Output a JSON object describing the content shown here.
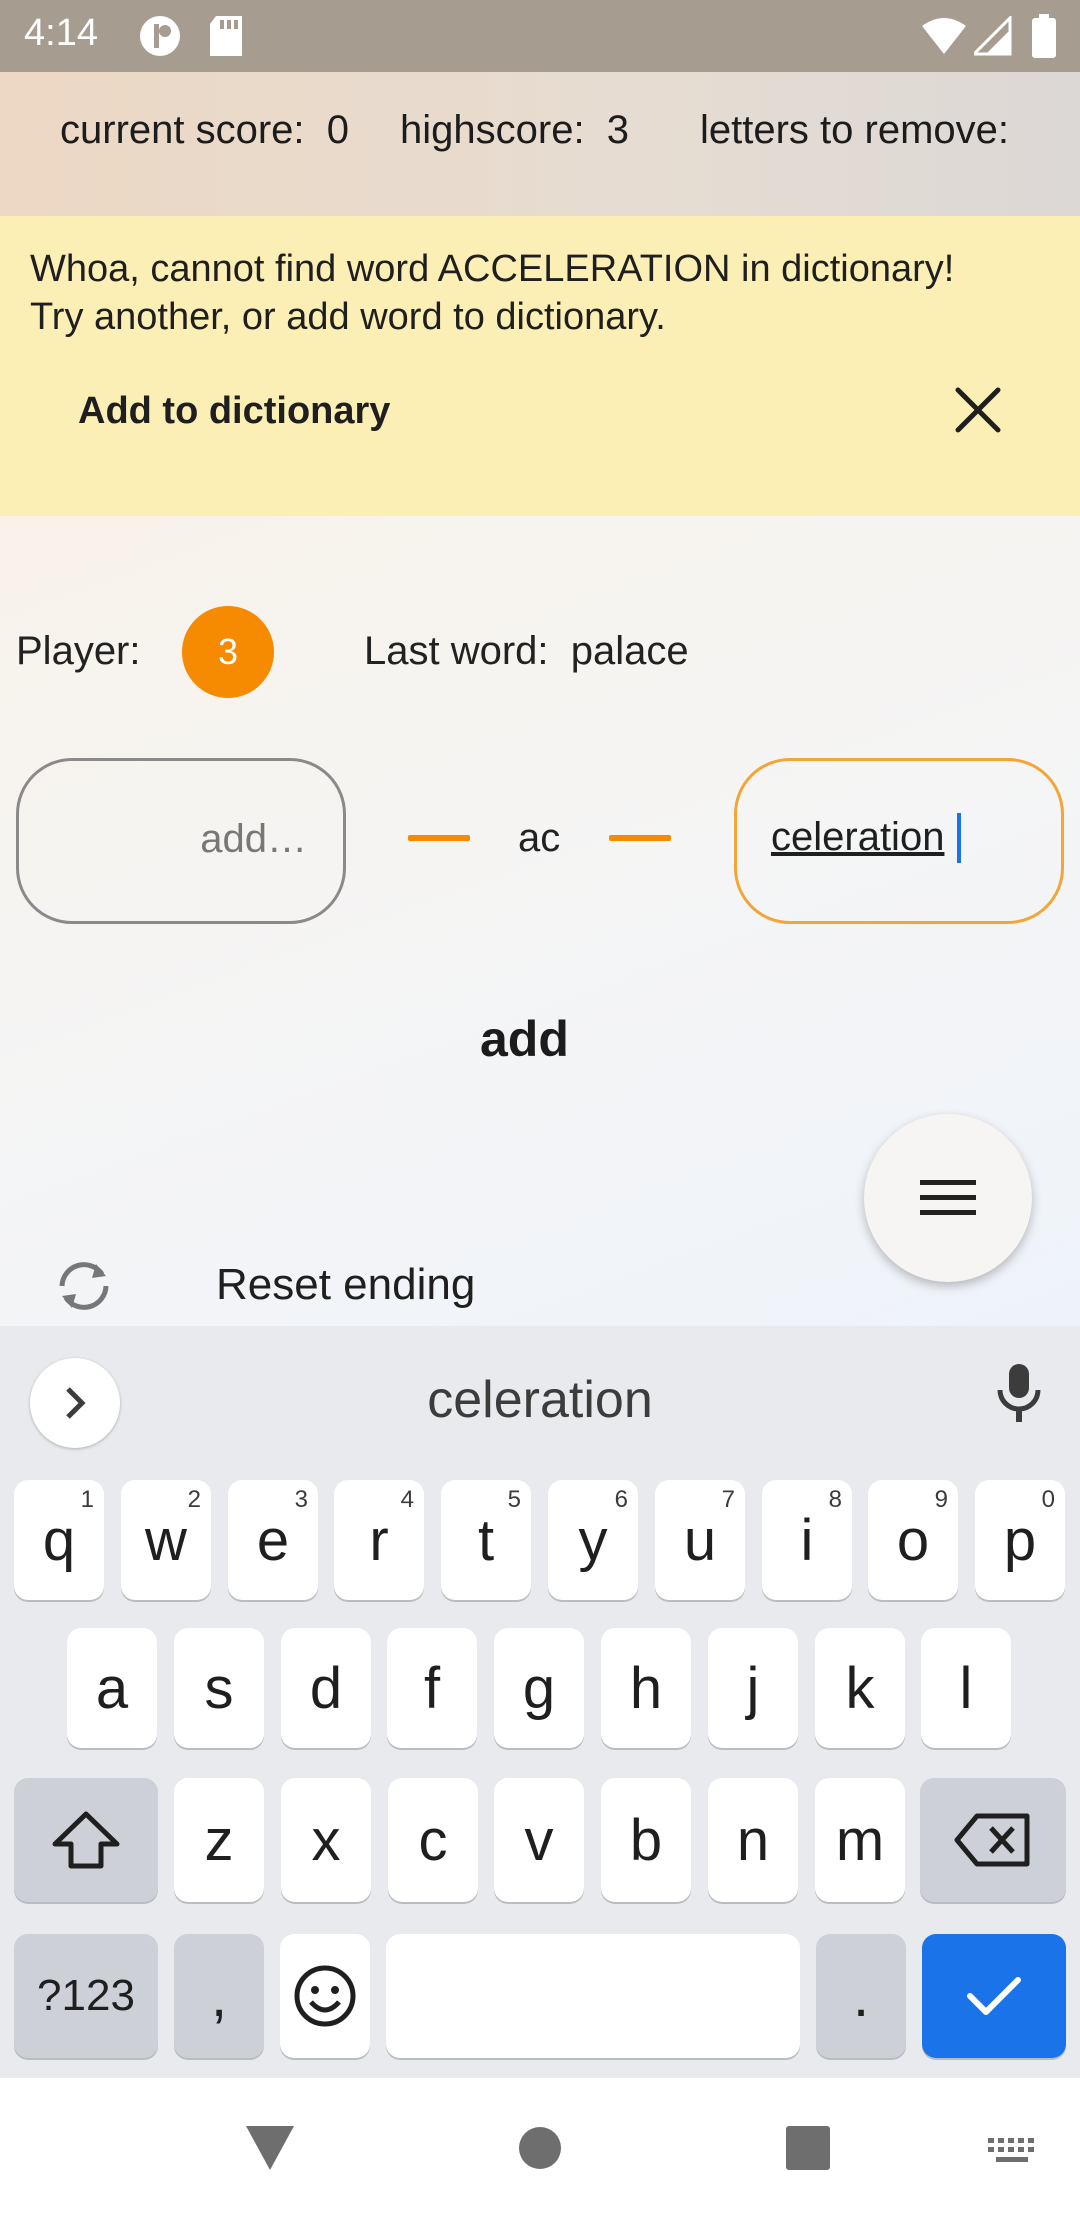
{
  "status_bar": {
    "time": "4:14"
  },
  "score_bar": {
    "current_score": "current score:  0",
    "highscore": "highscore:  3",
    "letters_to_remove": "letters to remove:"
  },
  "banner": {
    "line1": "Whoa, cannot find word ACCELERATION in dictionary!",
    "line2": "Try another, or add word to dictionary.",
    "action": "Add to dictionary",
    "bg_color": "#fcefb6"
  },
  "game": {
    "player_label": "Player:",
    "player_number": "3",
    "last_word": "Last word:  palace",
    "prefix_placeholder": "add…",
    "middle": "ac",
    "suffix_value": "celeration",
    "add_label": "add",
    "reset_label": "Reset ending",
    "accent_color": "#f68a00"
  },
  "keyboard": {
    "suggestion": "celeration",
    "row1": [
      {
        "k": "q",
        "h": "1"
      },
      {
        "k": "w",
        "h": "2"
      },
      {
        "k": "e",
        "h": "3"
      },
      {
        "k": "r",
        "h": "4"
      },
      {
        "k": "t",
        "h": "5"
      },
      {
        "k": "y",
        "h": "6"
      },
      {
        "k": "u",
        "h": "7"
      },
      {
        "k": "i",
        "h": "8"
      },
      {
        "k": "o",
        "h": "9"
      },
      {
        "k": "p",
        "h": "0"
      }
    ],
    "row2": [
      "a",
      "s",
      "d",
      "f",
      "g",
      "h",
      "j",
      "k",
      "l"
    ],
    "row3": [
      "z",
      "x",
      "c",
      "v",
      "b",
      "n",
      "m"
    ],
    "symbols": "?123",
    "comma": ",",
    "period": ".",
    "enter_color": "#1a73e8"
  }
}
